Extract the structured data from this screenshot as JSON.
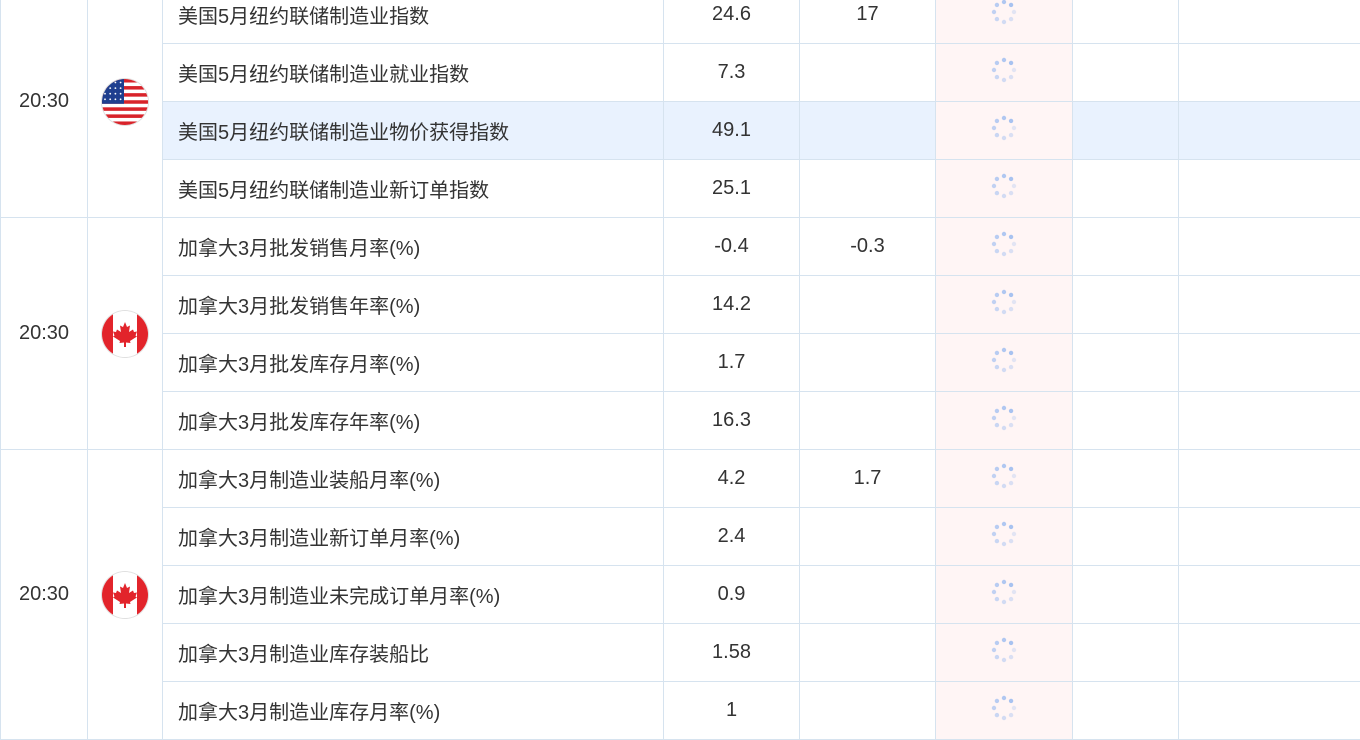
{
  "icons": {
    "us_flag": "us-flag-icon",
    "ca_flag": "canada-flag-icon",
    "loading": "loading-spinner-icon"
  },
  "colors": {
    "border": "#d6e3ef",
    "highlight_row": "#e9f2fe",
    "actual_column_bg": "#fff5f5",
    "spinner": "#9fbdf0"
  },
  "groups": [
    {
      "time": "20:30",
      "country": "us",
      "rows": [
        {
          "name": "美国5月纽约联储制造业指数",
          "previous": "24.6",
          "forecast": "17"
        },
        {
          "name": "美国5月纽约联储制造业就业指数",
          "previous": "7.3",
          "forecast": ""
        },
        {
          "name": "美国5月纽约联储制造业物价获得指数",
          "previous": "49.1",
          "forecast": ""
        },
        {
          "name": "美国5月纽约联储制造业新订单指数",
          "previous": "25.1",
          "forecast": ""
        }
      ]
    },
    {
      "time": "20:30",
      "country": "ca",
      "rows": [
        {
          "name": "加拿大3月批发销售月率(%)",
          "previous": "-0.4",
          "forecast": "-0.3"
        },
        {
          "name": "加拿大3月批发销售年率(%)",
          "previous": "14.2",
          "forecast": ""
        },
        {
          "name": "加拿大3月批发库存月率(%)",
          "previous": "1.7",
          "forecast": ""
        },
        {
          "name": "加拿大3月批发库存年率(%)",
          "previous": "16.3",
          "forecast": ""
        }
      ]
    },
    {
      "time": "20:30",
      "country": "ca",
      "rows": [
        {
          "name": "加拿大3月制造业装船月率(%)",
          "previous": "4.2",
          "forecast": "1.7"
        },
        {
          "name": "加拿大3月制造业新订单月率(%)",
          "previous": "2.4",
          "forecast": ""
        },
        {
          "name": "加拿大3月制造业未完成订单月率(%)",
          "previous": "0.9",
          "forecast": ""
        },
        {
          "name": "加拿大3月制造业库存装船比",
          "previous": "1.58",
          "forecast": ""
        },
        {
          "name": "加拿大3月制造业库存月率(%)",
          "previous": "1",
          "forecast": ""
        }
      ]
    }
  ]
}
